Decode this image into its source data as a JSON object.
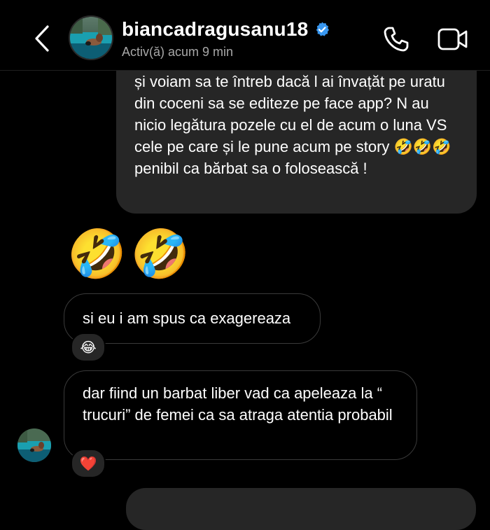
{
  "header": {
    "username": "biancadragusanu18",
    "status": "Activ(ă) acum 9 min",
    "verified": true
  },
  "messages": {
    "outgoing_text": "și voiam sa te întreb dacă l ai învațăt pe uratu din coceni sa se editeze pe face app? N au nicio legătura pozele cu el de acum o luna VS cele pe care și le pune acum pe story 🤣🤣🤣penibil ca bărbat sa o folosească !",
    "emoji_message": "🤣🤣",
    "incoming_1": "si eu i am spus ca exagereaza",
    "incoming_1_reaction": "😂",
    "incoming_2": "dar fiind un barbat liber vad ca apeleaza la “ trucuri” de femei ca sa atraga atentia probabil",
    "incoming_2_reaction": "❤️"
  },
  "icons": {
    "back": "chevron-left-icon",
    "verified": "verified-badge-icon",
    "call": "phone-icon",
    "video": "video-camera-icon"
  },
  "colors": {
    "background": "#000000",
    "outgoing_bubble": "#262626",
    "incoming_border": "#3a3a3a",
    "verified_blue": "#3897f0",
    "status_gray": "#a8a8a8"
  }
}
